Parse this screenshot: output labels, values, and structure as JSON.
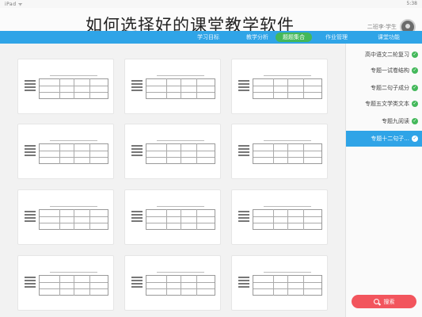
{
  "status_bar": {
    "left": "iPad ᯤ",
    "right": "5:38"
  },
  "title": "如何选择好的课堂教学软件",
  "user": {
    "name": "二班李·学生"
  },
  "nav": {
    "tabs": [
      {
        "label": "课堂功能"
      },
      {
        "label": "作业管理"
      },
      {
        "label": "教学分析"
      },
      {
        "label": "题题集合"
      },
      {
        "label": "学习目标"
      }
    ],
    "active_index": 3
  },
  "cards": [
    {},
    {},
    {},
    {},
    {},
    {},
    {},
    {},
    {},
    {},
    {},
    {}
  ],
  "sidebar": {
    "items": [
      {
        "label": "高中语文二轮复习",
        "checked": true
      },
      {
        "label": "专题一试卷结构",
        "checked": true
      },
      {
        "label": "专题二句子成分",
        "checked": true
      },
      {
        "label": "专题五文学类文本",
        "checked": true
      },
      {
        "label": "专题九阅读",
        "checked": true
      },
      {
        "label": "专题十二句子...",
        "checked": true
      }
    ],
    "active_index": 5
  },
  "search_button": {
    "label": "搜索"
  },
  "colors": {
    "nav": "#2fa4e7",
    "active_tab": "#43b85a",
    "search": "#f2555d"
  }
}
